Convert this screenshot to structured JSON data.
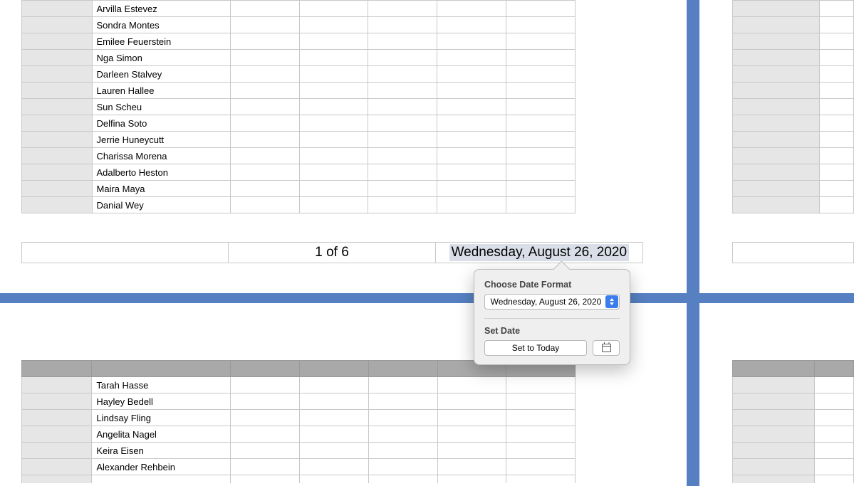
{
  "tables": {
    "page1_names": [
      "Arvilla Estevez",
      "Sondra Montes",
      "Emilee Feuerstein",
      "Nga Simon",
      "Darleen Stalvey",
      "Lauren Hallee",
      "Sun Scheu",
      "Delfina Soto",
      "Jerrie Huneycutt",
      "Charissa Morena",
      "Adalberto Heston",
      "Maira Maya",
      "Danial Wey"
    ],
    "page3_names": [
      "Tarah Hasse",
      "Hayley Bedell",
      "Lindsay Fling",
      "Angelita Nagel",
      "Keira Eisen",
      "Alexander Rehbein"
    ]
  },
  "footer": {
    "page_indicator": "1 of 6",
    "date_text": "Wednesday, August 26, 2020"
  },
  "popover": {
    "format_label": "Choose Date Format",
    "format_value": "Wednesday, August 26, 2020",
    "setdate_label": "Set Date",
    "today_button": "Set to Today"
  }
}
